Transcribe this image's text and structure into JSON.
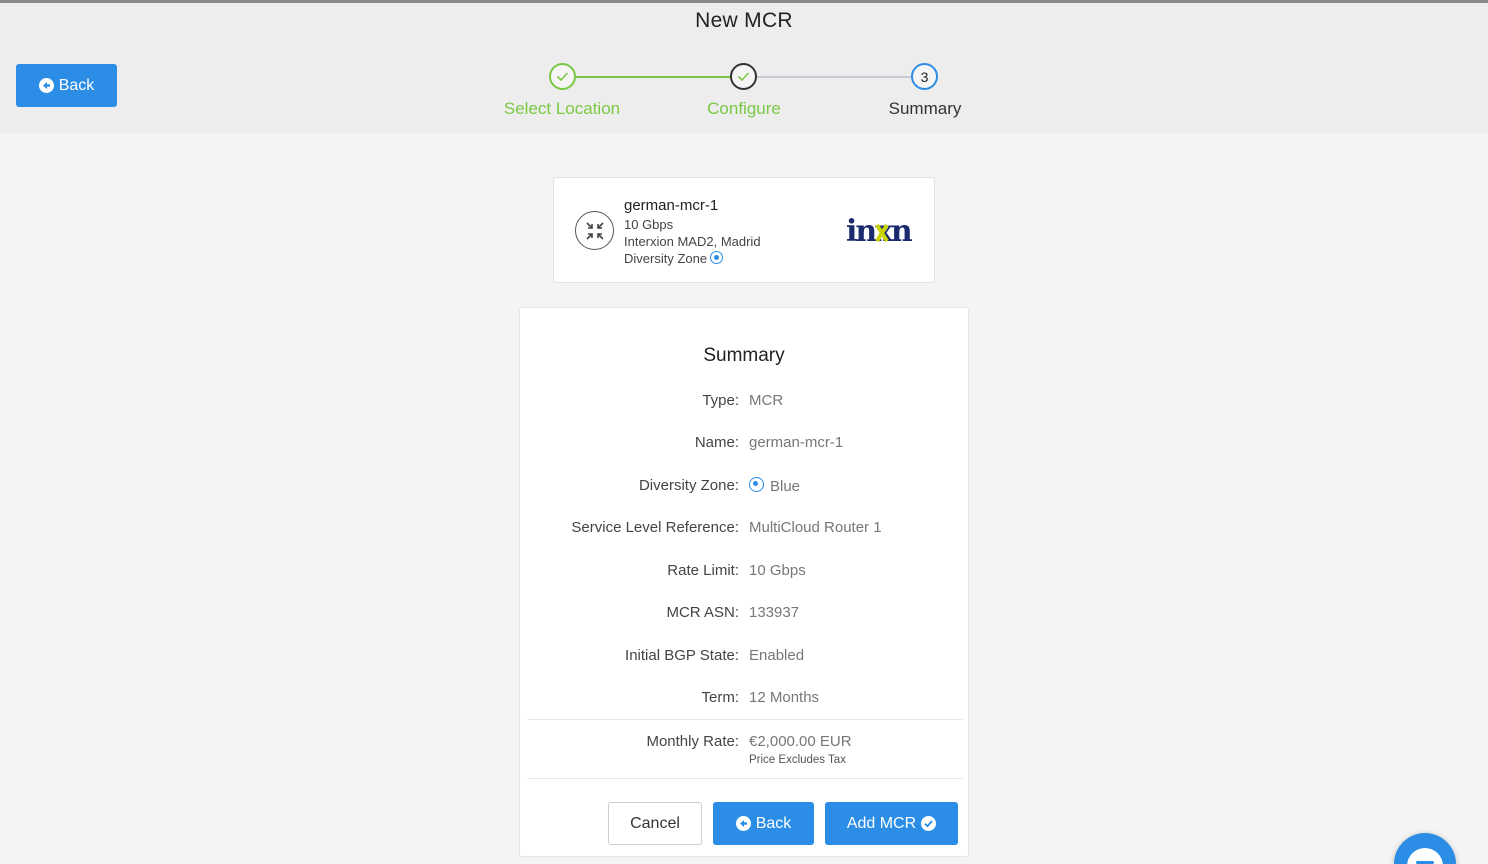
{
  "header": {
    "title": "New MCR",
    "back_label": "Back"
  },
  "stepper": {
    "steps": [
      {
        "label": "Select Location",
        "state": "complete"
      },
      {
        "label": "Configure",
        "state": "complete"
      },
      {
        "label": "Summary",
        "state": "current",
        "number": "3"
      }
    ]
  },
  "location_card": {
    "name": "german-mcr-1",
    "speed": "10 Gbps",
    "location": "Interxion MAD2, Madrid",
    "zone_label": "Diversity Zone",
    "logo_text": "inxn"
  },
  "summary": {
    "title": "Summary",
    "rows": [
      {
        "label": "Type:",
        "value": "MCR"
      },
      {
        "label": "Name:",
        "value": "german-mcr-1"
      },
      {
        "label": "Diversity Zone:",
        "value": "Blue"
      },
      {
        "label": "Service Level Reference:",
        "value": "MultiCloud Router 1"
      },
      {
        "label": "Rate Limit:",
        "value": "10 Gbps"
      },
      {
        "label": "MCR ASN:",
        "value": "133937"
      },
      {
        "label": "Initial BGP State:",
        "value": "Enabled"
      },
      {
        "label": "Term:",
        "value": "12 Months"
      }
    ],
    "monthly": {
      "label": "Monthly Rate:",
      "value": "€2,000.00 EUR",
      "note": "Price Excludes Tax"
    },
    "buttons": {
      "cancel": "Cancel",
      "back": "Back",
      "add": "Add MCR"
    }
  },
  "colors": {
    "accent": "#2b8de6",
    "complete": "#7ac943",
    "current_step_text": "#333333"
  }
}
